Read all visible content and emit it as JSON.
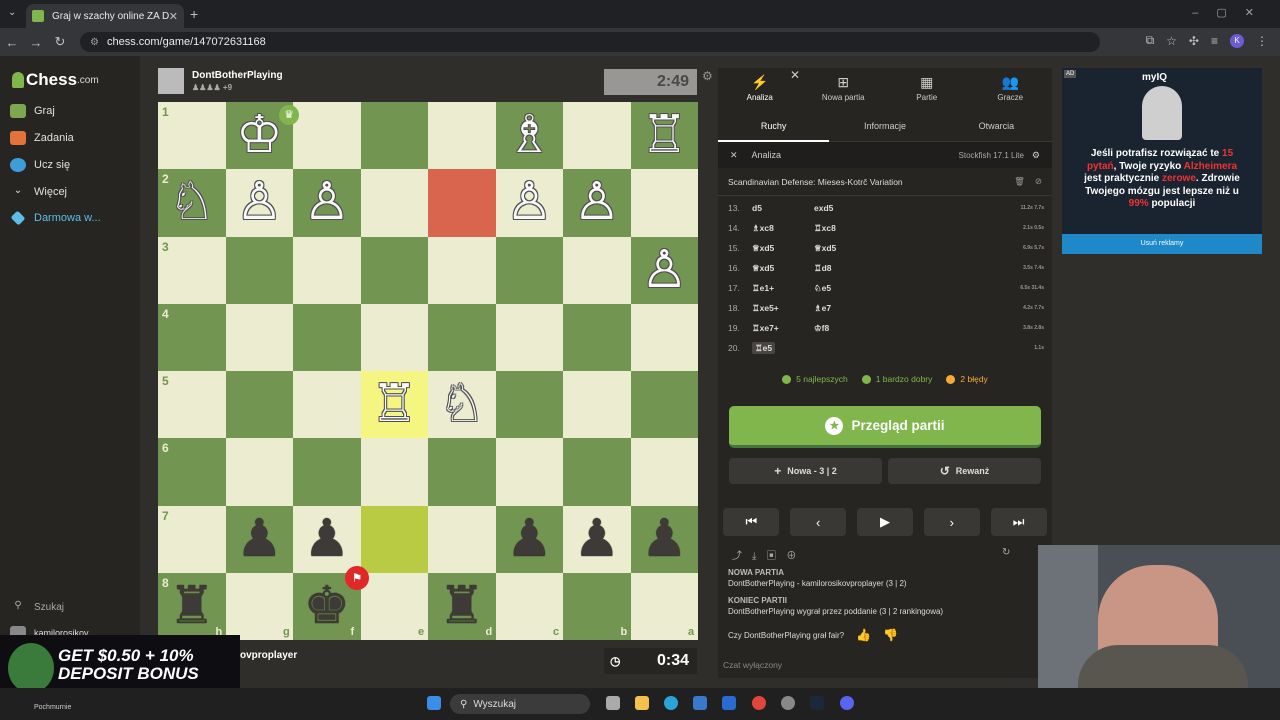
{
  "browser": {
    "tab_title": "Graj w szachy online ZA DARMO",
    "url": "chess.com/game/147072631168",
    "profile_initial": "K"
  },
  "sidebar": {
    "logo": "Chess",
    "logo_suffix": ".com",
    "items": [
      {
        "label": "Graj"
      },
      {
        "label": "Zadania"
      },
      {
        "label": "Ucz się"
      },
      {
        "label": "Więcej"
      },
      {
        "label": "Darmowa w..."
      }
    ],
    "search_label": "Szukaj",
    "user": "kamilorosikov"
  },
  "top_player": {
    "name": "DontBotherPlaying",
    "extra": "+9",
    "clock": "2:49"
  },
  "bottom_player": {
    "name": "kamilorosikovproplayer",
    "name_visible": "ovproplayer",
    "clock": "0:34"
  },
  "board": {
    "ranks": [
      "1",
      "2",
      "3",
      "4",
      "5",
      "6",
      "7",
      "8"
    ],
    "files": [
      "h",
      "g",
      "f",
      "e",
      "d",
      "c",
      "b",
      "a"
    ]
  },
  "panel": {
    "tabs": [
      {
        "label": "Analiza"
      },
      {
        "label": "Nowa partia"
      },
      {
        "label": "Partie"
      },
      {
        "label": "Gracze"
      }
    ],
    "subtabs": [
      {
        "label": "Ruchy"
      },
      {
        "label": "Informacje"
      },
      {
        "label": "Otwarcia"
      }
    ],
    "analysis_label": "Analiza",
    "engine": "Stockfish 17.1 Lite",
    "opening": "Scandinavian Defense: Mieses-Kotrč Variation",
    "moves": [
      {
        "n": "13.",
        "w": "d5",
        "b": "exd5",
        "t": "11.2s 7.7s"
      },
      {
        "n": "14.",
        "w": "♗xc8",
        "b": "♖xc8",
        "t": "2.1s 0.5s"
      },
      {
        "n": "15.",
        "w": "♕xd5",
        "b": "♕xd5",
        "t": "6.9s 5.7s"
      },
      {
        "n": "16.",
        "w": "♕xd5",
        "b": "♖d8",
        "t": "3.5s 7.4s"
      },
      {
        "n": "17.",
        "w": "♖e1+",
        "b": "♘e5",
        "t": "6.5s 31.4s"
      },
      {
        "n": "18.",
        "w": "♖xe5+",
        "b": "♗e7",
        "t": "4.2s 7.7s"
      },
      {
        "n": "19.",
        "w": "♖xe7+",
        "b": "♔f8",
        "t": "3.8s 2.8s"
      },
      {
        "n": "20.",
        "w": "♖e5",
        "b": "",
        "t": "1.1s"
      }
    ],
    "stats": [
      {
        "label": "5 najlepszych",
        "color": "#81b64c"
      },
      {
        "label": "1 bardzo dobry",
        "color": "#81b64c"
      },
      {
        "label": "2 błędy",
        "color": "#f7a93b"
      }
    ],
    "review_label": "Przegląd partii",
    "new_game_label": "Nowa - 3 | 2",
    "rematch_label": "Rewanż",
    "feed_new": "NOWA PARTIA",
    "feed_new_text": "DontBotherPlaying - kamilorosikovproplayer (3 | 2)",
    "feed_end": "KONIEC PARTII",
    "feed_end_text": "DontBotherPlaying wygrał przez poddanie (3 | 2 rankingowa)",
    "fair_q": "Czy DontBotherPlaying grał fair?",
    "chat_off": "Czat wyłączony"
  },
  "ad": {
    "brand": "myIQ",
    "text_1": "Jeśli potrafisz rozwiązać te",
    "text_2": "15 pytań",
    "text_3": ", Twoje ryzyko",
    "text_4": "Alzheimera",
    "text_5": "jest praktycznie",
    "text_6": "zerowe",
    "text_7": ". Zdrowie Twojego mózgu jest lepsze niż u",
    "text_8": "99%",
    "text_9": "populacji",
    "remove": "Usuń reklamy",
    "tag": "AD"
  },
  "promo": {
    "line1": "GET $0.50 + 10%",
    "line2": "DEPOSIT BONUS",
    "weather": "Pochmurnie"
  },
  "taskbar": {
    "search": "Wyszukaj"
  }
}
